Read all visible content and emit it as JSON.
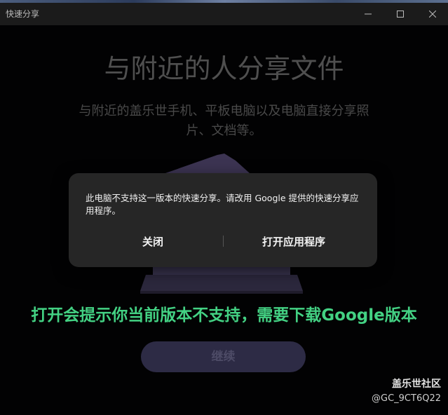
{
  "window": {
    "title": "快速分享"
  },
  "main": {
    "headline": "与附近的人分享文件",
    "subtitle": "与附近的盖乐世手机、平板电脑以及电脑直接分享照片、文档等。",
    "continue_label": "继续"
  },
  "dialog": {
    "message": "此电脑不支持这一版本的快速分享。请改用 Google 提供的快速分享应用程序。",
    "close_label": "关闭",
    "open_app_label": "打开应用程序"
  },
  "annotation": {
    "text": "打开会提示你当前版本不支持，需要下载Google版本"
  },
  "watermark": {
    "site": "盖乐世社区",
    "user": "@GC_9CT6Q22"
  },
  "icons": {
    "minimize": "minimize-icon",
    "maximize": "maximize-icon",
    "close": "close-icon"
  },
  "colors": {
    "annotation": "#43d183",
    "dialog_bg": "#262626",
    "continue_bg": "#2d2b45"
  }
}
